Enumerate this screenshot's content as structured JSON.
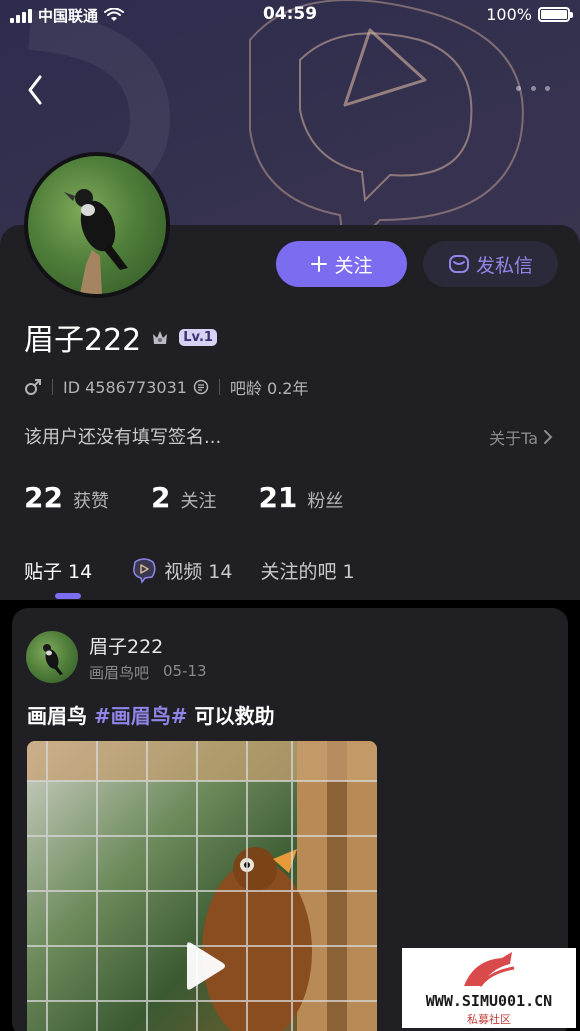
{
  "status_bar": {
    "carrier": "中国联通",
    "time": "04:59",
    "battery": "100%"
  },
  "profile": {
    "follow_label": "关注",
    "message_label": "发私信",
    "name": "眉子222",
    "level": "Lv.1",
    "id_text": "ID 4586773031",
    "bar_age": "吧龄 0.2年",
    "signature": "该用户还没有填写签名...",
    "about": "关于Ta"
  },
  "stats": [
    {
      "value": "22",
      "label": "获赞"
    },
    {
      "value": "2",
      "label": "关注"
    },
    {
      "value": "21",
      "label": "粉丝"
    }
  ],
  "tabs": [
    {
      "label": "贴子 14"
    },
    {
      "label": "视频 14"
    },
    {
      "label": "关注的吧 1"
    }
  ],
  "post": {
    "author": "眉子222",
    "forum": "画眉鸟吧",
    "date": "05-13",
    "title_prefix": "画眉鸟 ",
    "title_tag": "#画眉鸟#",
    "title_suffix": " 可以救助"
  },
  "watermark": {
    "text": "WWW.SIMU001.CN",
    "subtitle": "私募社区"
  },
  "colors": {
    "accent": "#7b6cf0",
    "card_bg": "#1f1f24",
    "header_bg": "#322f4e"
  }
}
